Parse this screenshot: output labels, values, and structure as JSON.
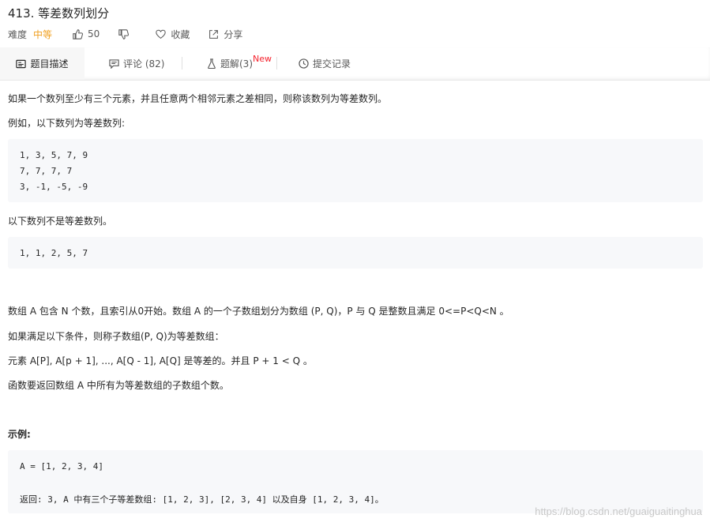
{
  "problem": {
    "title": "413. 等差数列划分",
    "difficulty_label": "难度",
    "difficulty_value": "中等",
    "likes": "50",
    "favorite_label": "收藏",
    "share_label": "分享"
  },
  "tabs": {
    "description": "题目描述",
    "comments": "评论 (82)",
    "solutions": "题解(3)",
    "solutions_badge": "New",
    "submissions": "提交记录"
  },
  "content": {
    "p1": "如果一个数列至少有三个元素，并且任意两个相邻元素之差相同，则称该数列为等差数列。",
    "p2": "例如，以下数列为等差数列:",
    "code1": [
      "1, 3, 5, 7, 9",
      "7, 7, 7, 7",
      "3, -1, -5, -9"
    ],
    "p3": "以下数列不是等差数列。",
    "code2": [
      "1, 1, 2, 5, 7"
    ],
    "p4": "数组 A 包含 N 个数，且索引从0开始。数组 A 的一个子数组划分为数组 (P, Q)，P 与 Q 是整数且满足 0<=P<Q<N 。",
    "p5": "如果满足以下条件，则称子数组(P, Q)为等差数组：",
    "p6": "元素 A[P], A[p + 1], ..., A[Q - 1], A[Q] 是等差的。并且 P + 1 < Q 。",
    "p7": "函数要返回数组 A 中所有为等差数组的子数组个数。",
    "example_heading": "示例:",
    "example_code": [
      "A = [1, 2, 3, 4]",
      "",
      "返回: 3, A 中有三个子等差数组: [1, 2, 3], [2, 3, 4] 以及自身 [1, 2, 3, 4]。"
    ]
  },
  "watermark": "https://blog.csdn.net/guaiguaitinghua",
  "colors": {
    "difficulty": "#f0a020",
    "badge": "#f5222d",
    "code_bg": "#f7f8fa"
  }
}
